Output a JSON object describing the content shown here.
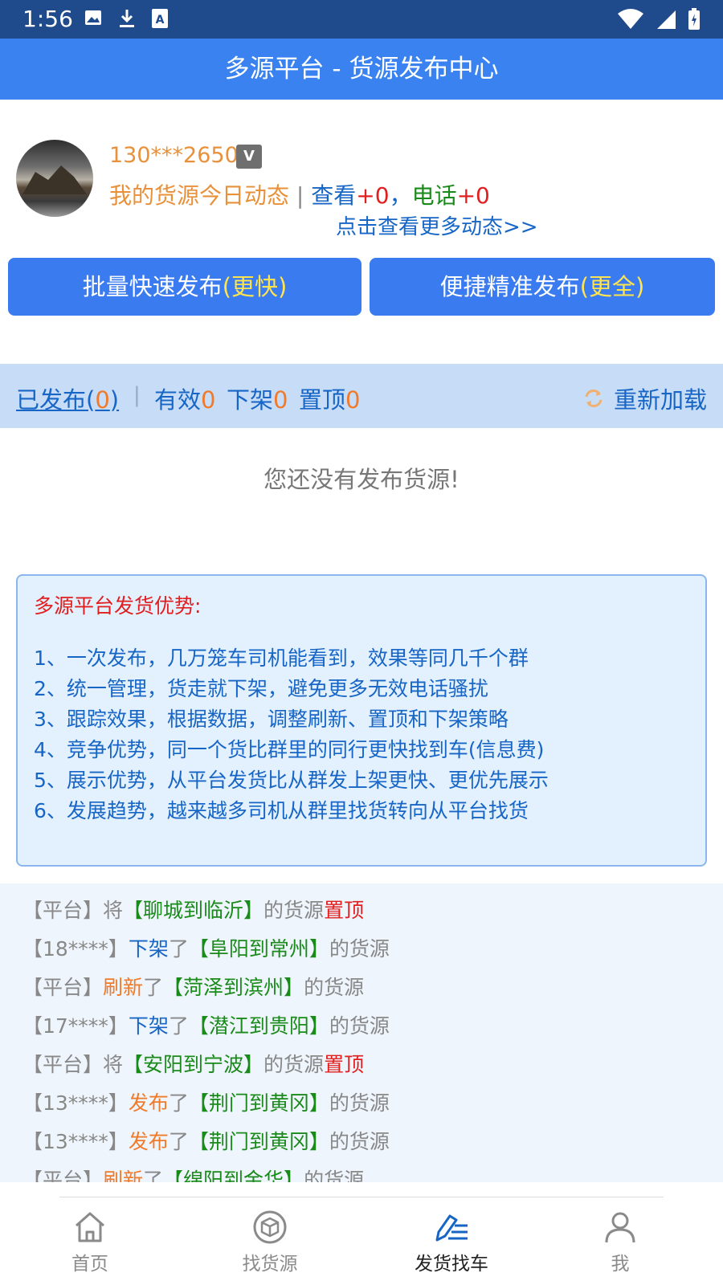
{
  "status_bar": {
    "time": "1:56"
  },
  "app_bar": {
    "title": "多源平台 - 货源发布中心"
  },
  "profile": {
    "phone": "130***2650",
    "vip_badge": "V",
    "dynamics_label": "我的货源今日动态",
    "separator": "|",
    "views_label": "查看",
    "views_count": "+0",
    "comma": "，",
    "calls_label": "电话",
    "calls_count": "+0",
    "more_link": "点击查看更多动态>>"
  },
  "actions": {
    "batch_label": "批量快速发布",
    "batch_hint": "(更快)",
    "precise_label": "便捷精准发布",
    "precise_hint": "(更全)"
  },
  "tabs": {
    "published_label": "已发布(",
    "published_count": "0",
    "published_close": ")",
    "bar": "|",
    "valid_label": "有效",
    "valid_count": "0",
    "removed_label": "下架",
    "removed_count": "0",
    "top_label": "置顶",
    "top_count": "0",
    "reload_label": "重新加载"
  },
  "empty_message": "您还没有发布货源!",
  "advantages": {
    "title": "多源平台发货优势:",
    "items": [
      "1、一次发布，几万笼车司机能看到，效果等同几千个群",
      "2、统一管理，货走就下架，避免更多无效电话骚扰",
      "3、跟踪效果，根据数据，调整刷新、置顶和下架策略",
      "4、竞争优势，同一个货比群里的同行更快找到车(信息费)",
      "5、展示优势，从平台发货比从群发上架更快、更优先展示",
      "6、发展趋势，越来越多司机从群里找货转向从平台找货"
    ]
  },
  "feed": [
    {
      "who": "【平台】",
      "verb": "将",
      "route": "【聊城到临沂】",
      "suffix": "的货源",
      "tail": "置顶",
      "kind": "top"
    },
    {
      "who": "【18****】",
      "verb": "下架",
      "le": "了",
      "route": "【阜阳到常州】",
      "suffix": "的货源",
      "kind": "remove"
    },
    {
      "who": "【平台】",
      "verb": "刷新",
      "le": "了",
      "route": "【菏泽到滨州】",
      "suffix": "的货源",
      "kind": "refresh"
    },
    {
      "who": "【17****】",
      "verb": "下架",
      "le": "了",
      "route": "【潜江到贵阳】",
      "suffix": "的货源",
      "kind": "remove"
    },
    {
      "who": "【平台】",
      "verb": "将",
      "route": "【安阳到宁波】",
      "suffix": "的货源",
      "tail": "置顶",
      "kind": "top"
    },
    {
      "who": "【13****】",
      "verb": "发布",
      "le": "了",
      "route": "【荆门到黄冈】",
      "suffix": "的货源",
      "kind": "publish"
    },
    {
      "who": "【13****】",
      "verb": "发布",
      "le": "了",
      "route": "【荆门到黄冈】",
      "suffix": "的货源",
      "kind": "publish"
    },
    {
      "who": "【平台】",
      "verb": "刷新",
      "le": "了",
      "route": "【绵阳到金华】",
      "suffix": "的货源",
      "kind": "refresh"
    }
  ],
  "bottom_nav": [
    {
      "label": "首页",
      "icon": "home-icon"
    },
    {
      "label": "找货源",
      "icon": "cargo-box-icon"
    },
    {
      "label": "发货找车",
      "icon": "publish-pen-icon",
      "active": true
    },
    {
      "label": "我",
      "icon": "person-icon"
    }
  ],
  "colors": {
    "status_bar": "#1f4a8c",
    "app_bar": "#3a82f0",
    "button": "#3a7bf0",
    "button_hint": "#ffe44d",
    "link_blue": "#1766c6",
    "orange": "#e8913a",
    "red": "#e02020",
    "green": "#1a8a1a"
  }
}
